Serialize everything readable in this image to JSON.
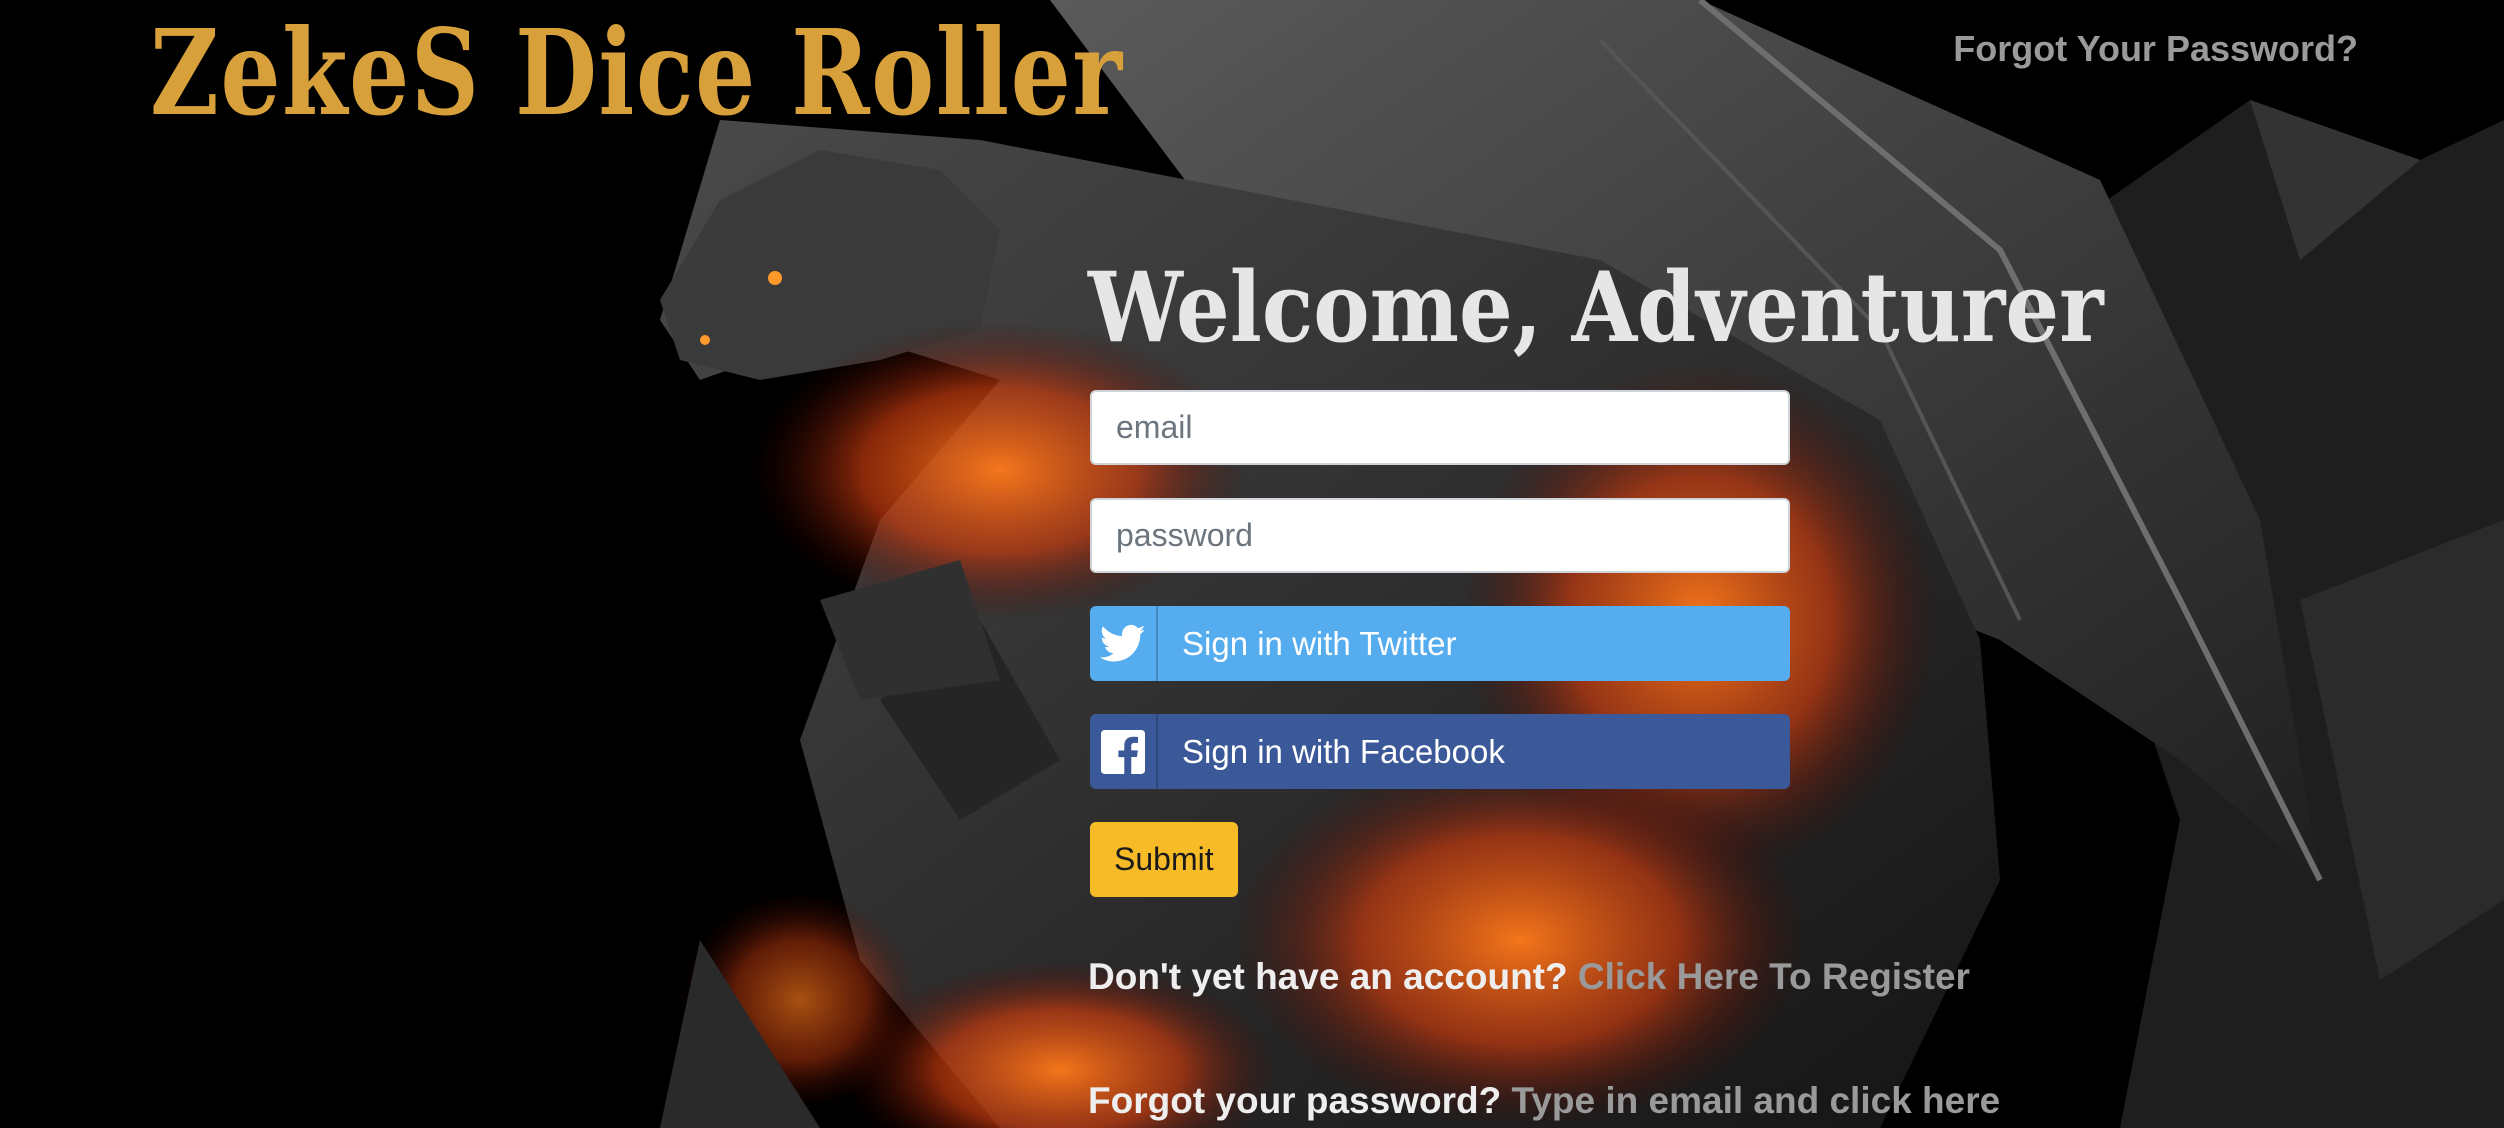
{
  "brand": {
    "title": "ZekeS Dice Roller"
  },
  "header": {
    "forgot_link": "Forgot Your Password?"
  },
  "login": {
    "heading": "Welcome, Adventurer",
    "email_placeholder": "email",
    "password_placeholder": "password",
    "twitter_label": "Sign in with Twitter",
    "facebook_label": "Sign in with Facebook",
    "submit_label": "Submit"
  },
  "register": {
    "prompt": "Don't yet have an account?",
    "link": "Click Here To Register"
  },
  "forgot": {
    "prompt": "Forgot your password?",
    "link": "Type in email and click here"
  },
  "colors": {
    "brand": "#d8a03a",
    "twitter": "#55acee",
    "facebook": "#3b5998",
    "submit": "#f7bb28",
    "link": "#9a9a9a"
  },
  "icons": {
    "twitter": "twitter-bird-icon",
    "facebook": "facebook-f-icon"
  }
}
